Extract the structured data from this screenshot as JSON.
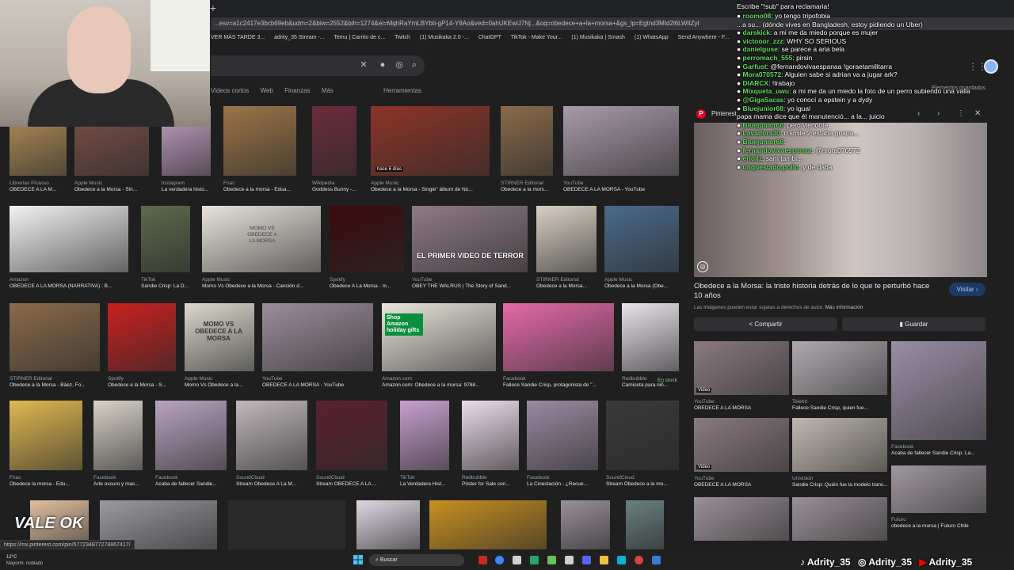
{
  "browser": {
    "address": "...esv=a1c2417e3bcb69eb&udm=2&biw=2552&bih=1274&ei=MqhRaYmLBYbti-gP14-Y8Ao&ved=0ahUKEwiJ7Nj...&oq=obedece+a+la+morsa+&gs_lp=Egtnd3Mtd2l6LWltZyI",
    "bookmarks": [
      "VER MÁS TARDE 3...",
      "adrity_35 Stream -...",
      "Temu | Carrito de c...",
      "Twitch",
      "(1) Musikaka 2.0 -...",
      "ChatGPT",
      "TikTok - Make Your...",
      "(1) Musikaka | Smash",
      "(1) WhatsApp",
      "Send Anywhere - F..."
    ],
    "status_url": "https://mx.pinterest.com/pin/577234877278867417/"
  },
  "search": {
    "filters": [
      "Videos cortos",
      "Web",
      "Finanzas",
      "Más"
    ],
    "tools": "Herramientas",
    "saved": "Elementos guardados"
  },
  "chat": {
    "header": "Escribe \"!sub\" para reclamaria!",
    "messages": [
      {
        "user": "roomo08",
        "text": "yo tengo tripofobia"
      },
      {
        "user": "",
        "text": "...a su... (dónde vives en Bangladesh, estoy pidiendo un Uber)"
      },
      {
        "user": "darskick",
        "text": "a mi me da miedo porque es mujer"
      },
      {
        "user": "victooor_zzz",
        "text": "WHY SO SERIOUS"
      },
      {
        "user": "danielguse",
        "text": "se parece a aria bela"
      },
      {
        "user": "perromach_555",
        "text": "pirsin"
      },
      {
        "user": "Garfust",
        "text": "@fernandovivaespanaa !goraetamilitarra"
      },
      {
        "user": "Mora070572",
        "text": "Alguien sabe si adrian va a jugar ark?"
      },
      {
        "user": "DIARCX",
        "text": "!trabajo"
      },
      {
        "user": "Mixqueta_uwu",
        "text": "a mi me da un miedo la foto de un perro subiendo una valla"
      },
      {
        "user": "@GigaSacas",
        "text": "yo conocí a epstein y a dydy"
      },
      {
        "user": "Bluejunior68",
        "text": "yo igual"
      },
      {
        "user": "",
        "text": "papa mama dice que él manutenció... a la... juicio"
      },
      {
        "user": "Bluejunior68",
        "text": "pero viendote"
      },
      {
        "user": "Lavadora30",
        "text": "d smile 2 estaba guapa..."
      },
      {
        "user": "Bluejunior68",
        "text": ""
      },
      {
        "user": "fernandovivaespanaa",
        "text": "@mora070572"
      },
      {
        "user": "erlollz",
        "text": "sam tambi..."
      },
      {
        "user": "unquestado.pollo",
        "text": "y de daba"
      }
    ]
  },
  "grid": [
    {
      "src": "Librerías Picasso",
      "title": "OBEDECE A LA M...",
      "c": "#b8925a"
    },
    {
      "src": "Apple Music",
      "title": "Obedece a la Morsa - Sin...",
      "c": "#7d5048"
    },
    {
      "src": "Instagram",
      "title": "La verdadera histo...",
      "c": "#c9a4c9"
    },
    {
      "src": "Fnac",
      "title": "Obedece a la morsa - Edua...",
      "c": "#9c7448"
    },
    {
      "src": "Wikipedia",
      "title": "Goddess Bunny -...",
      "c": "#6b2c3c"
    },
    {
      "src": "Apple Music",
      "title": "Obedece a la Morsa - Single\" álbum de No...",
      "c": "#8c3428"
    },
    {
      "src": "STIRNER Editorial",
      "title": "Obedece a la mors...",
      "c": "#8a6a4a"
    },
    {
      "src": "YouTube",
      "title": "OBEDECE A LA MORSA - YouTube",
      "c": "#a89aa8"
    },
    {
      "src": "Amazon",
      "title": "OBEDECE A LA MORSA (NARRATIVA) : B...",
      "c": "#f2f2f2"
    },
    {
      "src": "TikTok",
      "title": "Sandie Crisp: La D...",
      "c": "#5c6a4a"
    },
    {
      "src": "Apple Music",
      "title": "Momo Vs Obedece a la Morsa - Canción d...",
      "c": "#e8e4dc"
    },
    {
      "src": "Spotify",
      "title": "Obedece A La Morsa - m...",
      "c": "#3a0a0c"
    },
    {
      "src": "YouTube",
      "title": "OBEY THE WALRUS | The Story of Sand...",
      "c": "#8d7a86"
    },
    {
      "src": "STIRNER Editorial",
      "title": "Obedece a la Morsa...",
      "c": "#d9d0c4"
    },
    {
      "src": "Apple Music",
      "title": "Obedece a la Morsa (Obe...",
      "c": "#4a6a8a"
    },
    {
      "src": "STIRNER Editorial",
      "title": "Obedece a la Morsa - Báez, Fo...",
      "c": "#8a6a4a"
    },
    {
      "src": "Spotify",
      "title": "Obedece a la Morsa - S...",
      "c": "#c82020"
    },
    {
      "src": "Apple Music",
      "title": "Momo Vs Obedece a la...",
      "c": "#dcd8cc"
    },
    {
      "src": "YouTube",
      "title": "OBEDECE A LA MORSA - YouTube",
      "c": "#9c8d9a"
    },
    {
      "src": "Amazon.com",
      "title": "Amazon.com: Obedece a la morsa: 9788...",
      "c": "#eae6dc"
    },
    {
      "src": "Facebook",
      "title": "Fallece Sandie Crisp, protagonista de \"...",
      "c": "#e46aa8"
    },
    {
      "src": "Redbubble",
      "title": "Camiseta para niñ...",
      "c": "#e9e3ea"
    },
    {
      "src": "Fnac",
      "title": "Obedece la morsa - Edu...",
      "c": "#e0b850"
    },
    {
      "src": "Facebook",
      "title": "Arte oscuro y mac...",
      "c": "#d8d2c8"
    },
    {
      "src": "Facebook",
      "title": "Acaba de fallecer Sandie...",
      "c": "#b8a4c0"
    },
    {
      "src": "SoundCloud",
      "title": "Stream Obedece A La M...",
      "c": "#c0b8bc"
    },
    {
      "src": "SoundCloud",
      "title": "Stream OBEDECE A LA ...",
      "c": "#5a2030"
    },
    {
      "src": "TikTok",
      "title": "La Verdadera Hist...",
      "c": "#c8a0d0"
    },
    {
      "src": "Redbubble",
      "title": "Póster for Sale con...",
      "c": "#ecdceb"
    },
    {
      "src": "Facebook",
      "title": "La Cinestación - ¿Recue...",
      "c": "#9a8aa0"
    },
    {
      "src": "SoundCloud",
      "title": "Stream Obedece a la mo...",
      "c": "#3a3838"
    },
    {
      "src": "",
      "title": "",
      "c": "#e0c0a0"
    },
    {
      "src": "",
      "title": "",
      "c": "#9a9aa0"
    },
    {
      "src": "",
      "title": "",
      "c": "#2a2a2a"
    },
    {
      "src": "",
      "title": "",
      "c": "#e0d8e4"
    },
    {
      "src": "",
      "title": "",
      "c": "#c89020"
    },
    {
      "src": "",
      "title": "",
      "c": "#9a9098"
    },
    {
      "src": "",
      "title": "",
      "c": "#6a8080"
    }
  ],
  "grid_texts": {
    "overlay_terror": "EL PRIMER VIDEO DE TERROR",
    "momo": "MOMO VS OBEDECE A LA MORSA",
    "vale": "VALE OK",
    "shop": "Shop Amazon holiday gifts",
    "time_badge": "hace 6 días",
    "in_stock": "En stock"
  },
  "panel": {
    "source": "Pinterest",
    "title": "Obedece a la Morsa: la triste historia detrás de lo que te perturbó hace 10 años",
    "visit": "Visitar",
    "note": "Las imágenes pueden estar sujetas a derechos de autor.",
    "note_link": "Más información",
    "share": "Compartir",
    "save": "Guardar",
    "related": [
      {
        "src": "YouTube",
        "title": "OBEDECE A LA MORSA",
        "badge": "Video"
      },
      {
        "src": "Telehit",
        "title": "Fallece Sandie Crisp, quien fue..."
      },
      {
        "src": "Facebook",
        "title": "Acaba de fallecer Sandie Crisp. La..."
      },
      {
        "src": "YouTube",
        "title": "OBEDECE A LA MORSA",
        "badge": "Video"
      },
      {
        "src": "Univision",
        "title": "Sandie Crisp: Quién fue la modelo trans..."
      },
      {
        "src": "Futuro",
        "title": "obedece a la morsa | Futuro Chile"
      }
    ]
  },
  "overlay": {
    "handles": [
      "Adrity_35",
      "Adrity_35",
      "Adrity_35"
    ]
  },
  "taskbar": {
    "weather_temp": "12°C",
    "weather_desc": "Mayorm. nublado",
    "search": "Buscar"
  }
}
